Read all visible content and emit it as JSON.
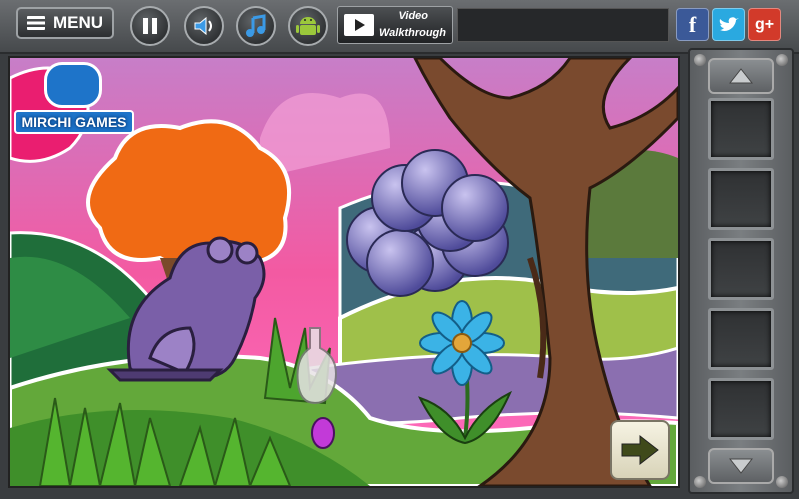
{
  "topbar": {
    "menu_label": "MENU",
    "video_line1": "Video",
    "video_line2": "Walkthrough"
  },
  "icons": {
    "pause": "pause-icon",
    "sound": "speaker-icon",
    "music": "music-note-icon",
    "android": "android-icon",
    "facebook": "facebook-icon",
    "twitter": "twitter-icon",
    "gplus": "google-plus-icon"
  },
  "social": {
    "facebook": "f",
    "gplus": "g+"
  },
  "logo": {
    "text": "MIRCHI GAMES"
  },
  "inventory": {
    "slots": 5
  },
  "colors": {
    "facebook": "#3b5998",
    "twitter": "#2aa9e0",
    "gplus": "#d23a2a",
    "brand": "#1e74c9"
  }
}
